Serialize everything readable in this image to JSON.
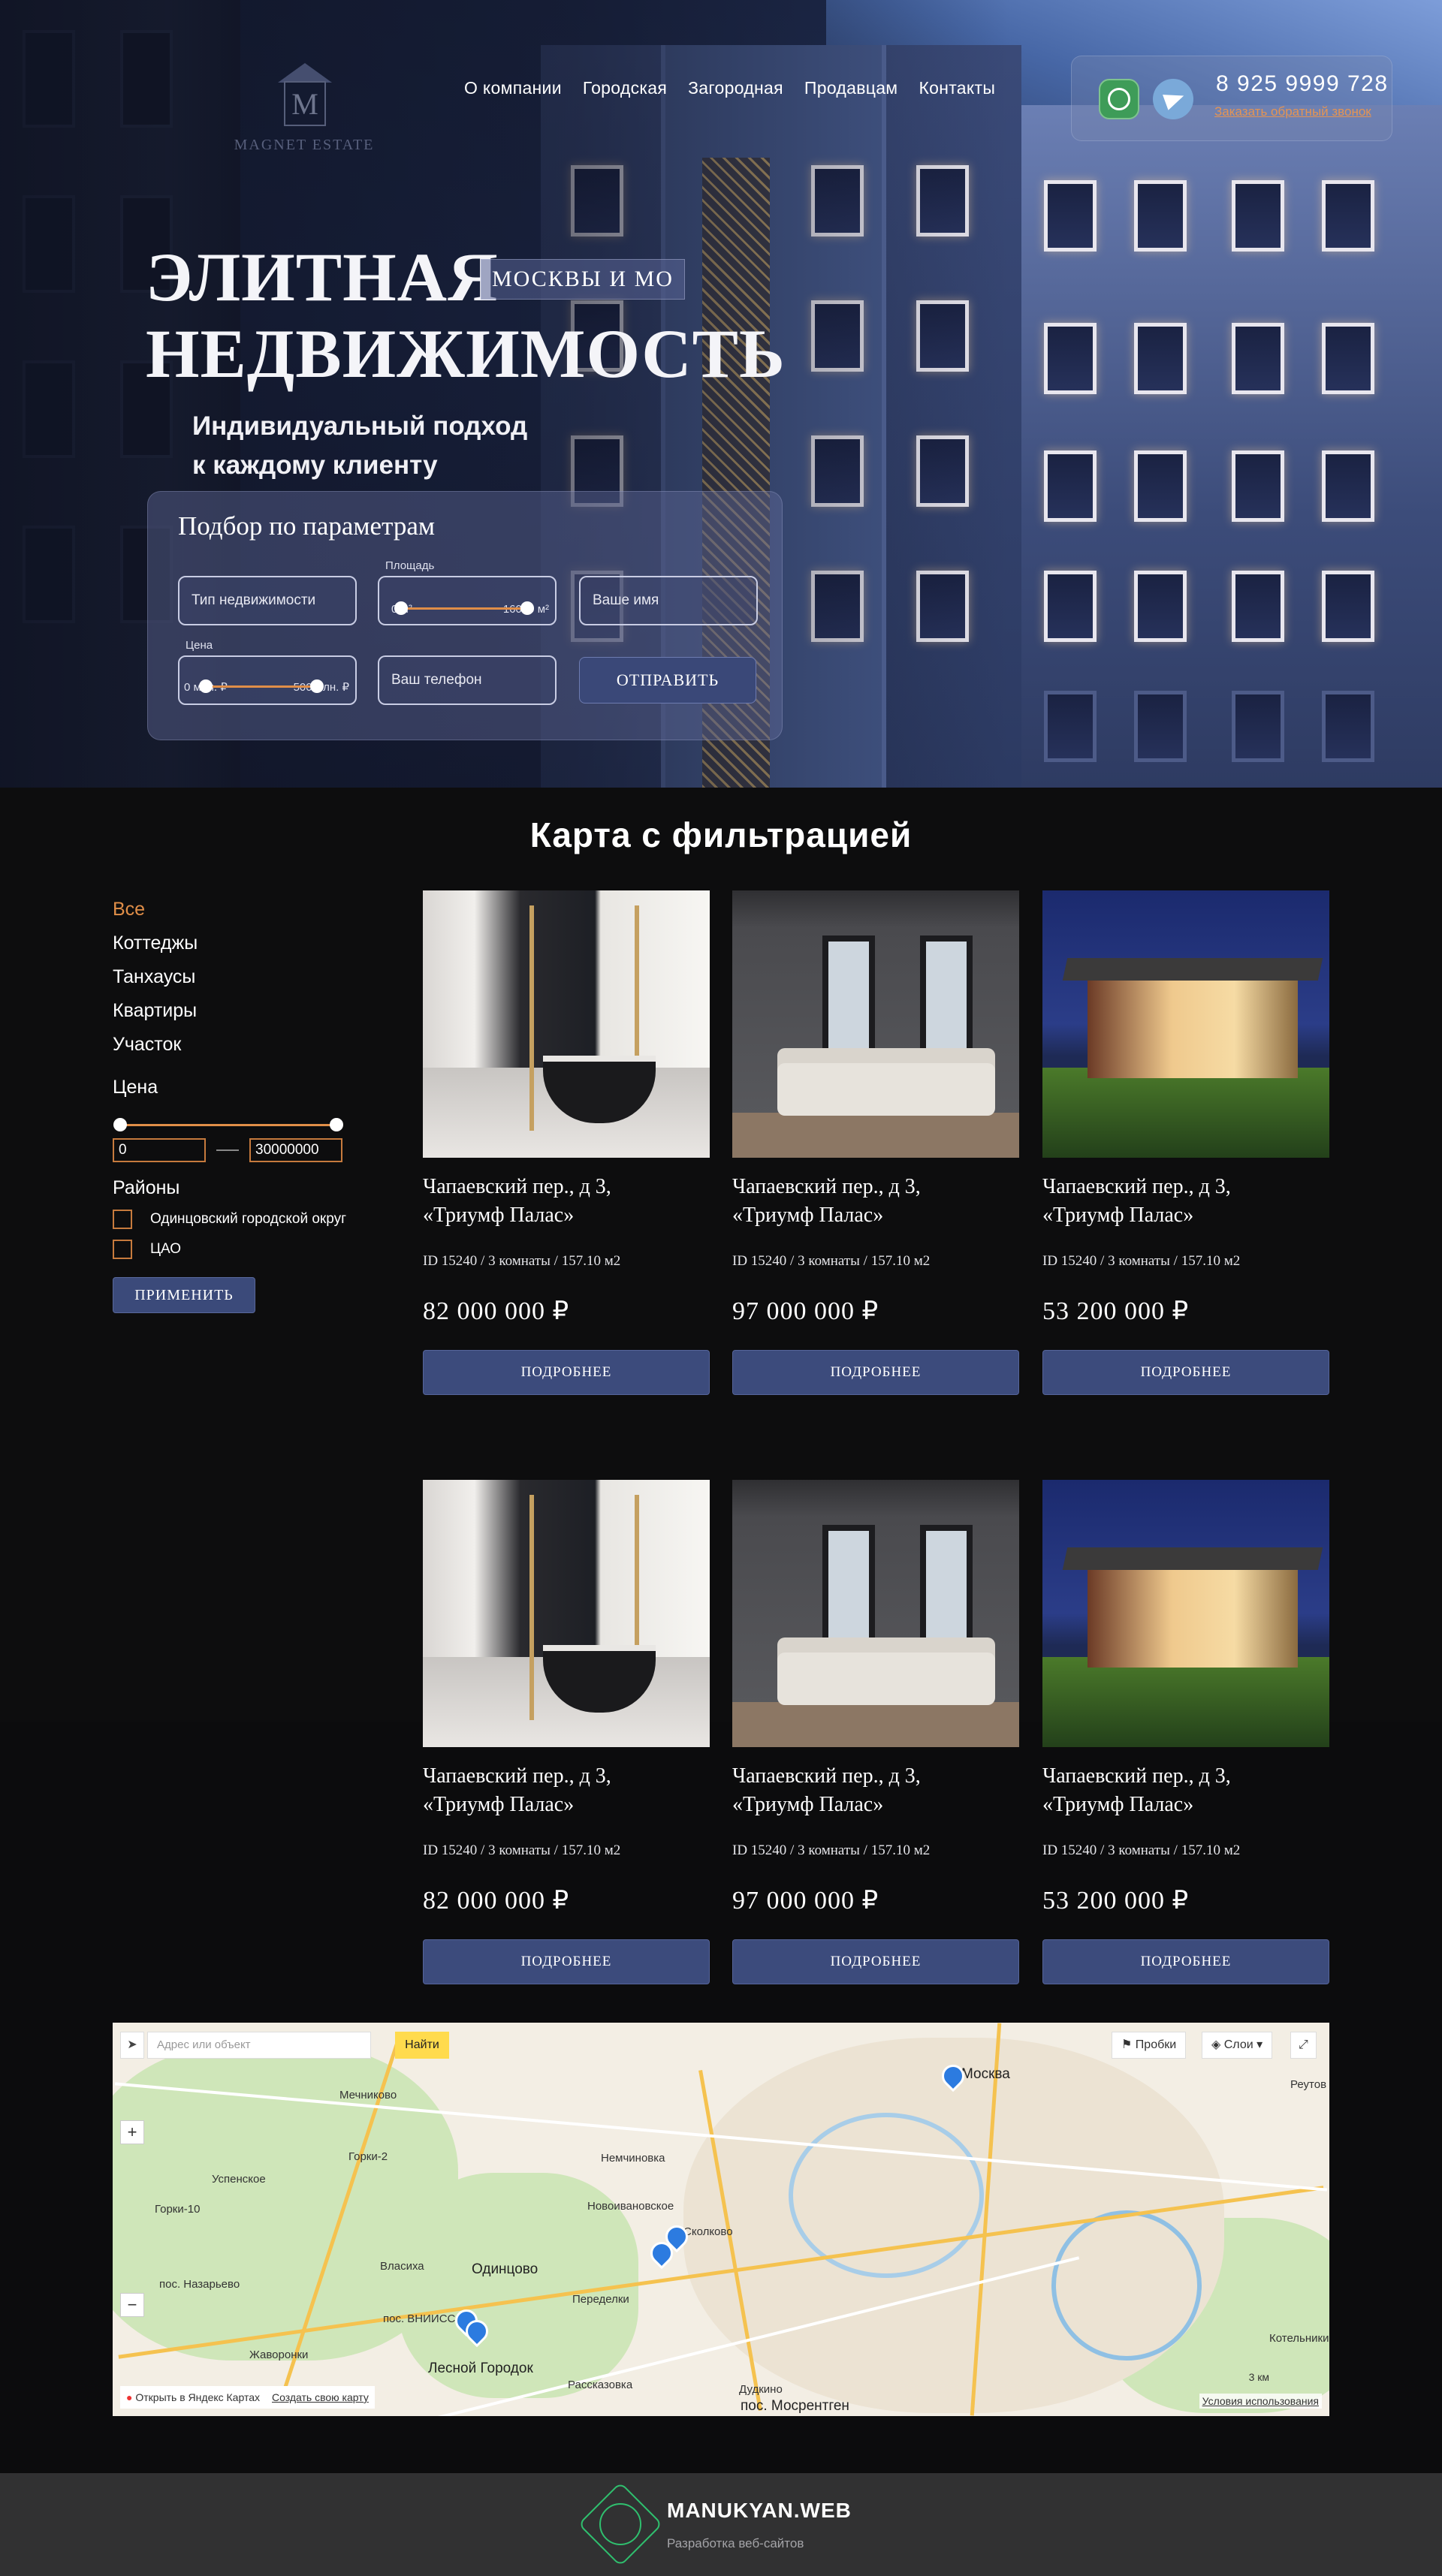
{
  "header": {
    "logo_name": "MAGNET ESTATE",
    "nav": [
      "О компании",
      "Городская",
      "Загородная",
      "Продавцам",
      "Контакты"
    ],
    "phone": "8 925 9999 728",
    "callback": "Заказать обратный звонок",
    "icons": [
      "whatsapp-icon",
      "telegram-icon"
    ]
  },
  "hero": {
    "title_line1": "ЭЛИТНАЯ",
    "title_line2": "НЕДВИЖИМОСТЬ",
    "tag": "МОСКВЫ И МО",
    "subtitle_line1": "Индивидуальный подход",
    "subtitle_line2": "к каждому клиенту"
  },
  "filter_form": {
    "title": "Подбор по параметрам",
    "type_placeholder": "Тип недвижимости",
    "area_label": "Площадь",
    "area_min": "0 м²",
    "area_max": "16000 м²",
    "name_placeholder": "Ваше имя",
    "price_label": "Цена",
    "price_min": "0 млн. ₽",
    "price_max": "500 млн. ₽",
    "phone_placeholder": "Ваш телефон",
    "submit": "ОТПРАВИТЬ"
  },
  "catalog": {
    "title": "Карта с фильтрацией",
    "categories": [
      "Все",
      "Коттеджы",
      "Танхаусы",
      "Квартиры",
      "Участок"
    ],
    "price_label": "Цена",
    "price_from": "0",
    "price_to": "30000000",
    "districts_label": "Районы",
    "districts": [
      "Одинцовский городской округ",
      "ЦАО"
    ],
    "apply": "ПРИМЕНИТЬ",
    "cards": [
      {
        "title1": "Чапаевский пер., д 3,",
        "title2": "«Триумф Палас»",
        "meta": "ID 15240 / 3 комнаты / 157.10 м2",
        "price": "82 000 000 ₽",
        "button": "ПОДРОБНЕЕ"
      },
      {
        "title1": "Чапаевский пер., д 3,",
        "title2": "«Триумф Палас»",
        "meta": "ID 15240 / 3 комнаты / 157.10 м2",
        "price": "97 000 000 ₽",
        "button": "ПОДРОБНЕЕ"
      },
      {
        "title1": "Чапаевский пер., д 3,",
        "title2": "«Триумф Палас»",
        "meta": "ID 15240 / 3 комнаты / 157.10 м2",
        "price": "53 200 000 ₽",
        "button": "ПОДРОБНЕЕ"
      },
      {
        "title1": "Чапаевский пер., д 3,",
        "title2": "«Триумф Палас»",
        "meta": "ID 15240 / 3 комнаты / 157.10 м2",
        "price": "82 000 000 ₽",
        "button": "ПОДРОБНЕЕ"
      },
      {
        "title1": "Чапаевский пер., д 3,",
        "title2": "«Триумф Палас»",
        "meta": "ID 15240 / 3 комнаты / 157.10 м2",
        "price": "97 000 000 ₽",
        "button": "ПОДРОБНЕЕ"
      },
      {
        "title1": "Чапаевский пер., д 3,",
        "title2": "«Триумф Палас»",
        "meta": "ID 15240 / 3 комнаты / 157.10 м2",
        "price": "53 200 000 ₽",
        "button": "ПОДРОБНЕЕ"
      }
    ]
  },
  "map": {
    "search_placeholder": "Адрес или объект",
    "find": "Найти",
    "traffic": "Пробки",
    "layers": "Слои",
    "open_in": "Открыть в Яндекс Картах",
    "create": "Создать свою карту",
    "terms": "Условия использования",
    "scale": "3 км",
    "places": [
      "Москва",
      "Одинцово",
      "Немчиновка",
      "Новоивановское",
      "Власиха",
      "Мечниково",
      "Горки-2",
      "Горки-10",
      "Успенское",
      "пос. Назарьево",
      "Жаворонки",
      "Лесной Городок",
      "пос. ВНИИССОК",
      "Переделки",
      "Рассказовка",
      "Дудкино",
      "пос. Мосрентген",
      "Котельники",
      "Реутов",
      "Сколково"
    ]
  },
  "footer": {
    "brand": "MANUKYAN.WEB",
    "sub": "Разработка веб-сайтов"
  },
  "colors": {
    "accent": "#e08e48",
    "button": "#3c4b7c",
    "bg": "#0d0d0e",
    "footer": "#313132"
  }
}
